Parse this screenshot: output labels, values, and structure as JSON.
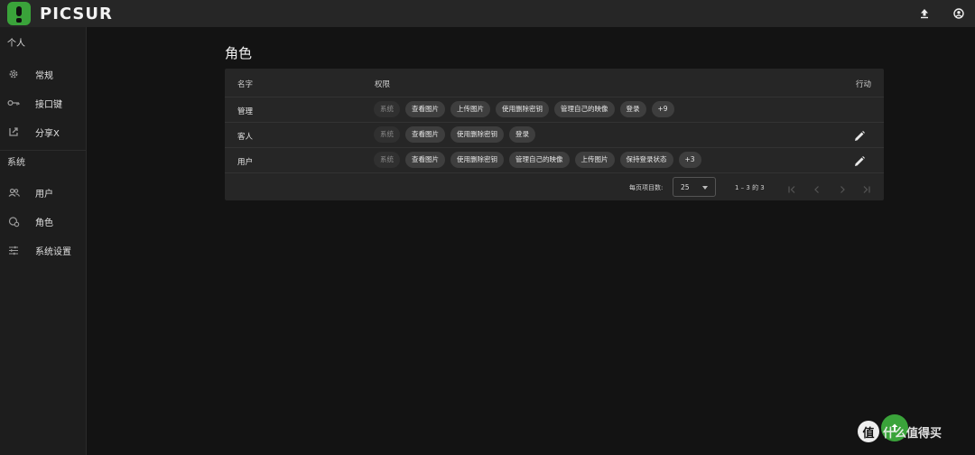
{
  "app": {
    "logo_text": "PICSUR",
    "brand_color": "#3aa33a"
  },
  "header_icons": [
    "upload-icon",
    "account-icon"
  ],
  "sidebar": {
    "section_personal": "个人",
    "section_system": "系统",
    "items": [
      {
        "label": "常规",
        "icon": "gear-icon"
      },
      {
        "label": "接口键",
        "icon": "key-icon"
      },
      {
        "label": "分享X",
        "icon": "share-icon"
      },
      {
        "label": "用户",
        "icon": "users-icon"
      },
      {
        "label": "角色",
        "icon": "roles-icon"
      },
      {
        "label": "系统设置",
        "icon": "sliders-icon"
      }
    ]
  },
  "main": {
    "title": "角色",
    "table": {
      "headers": {
        "name": "名字",
        "permissions": "权限",
        "actions": "行动"
      },
      "rows": [
        {
          "name": "管理",
          "chips": [
            "系统",
            "查看图片",
            "上传图片",
            "使用删除密钥",
            "管理自己的映像",
            "登录",
            "+9"
          ]
        },
        {
          "name": "客人",
          "chips": [
            "系统",
            "查看图片",
            "使用删除密钥",
            "登录"
          ]
        },
        {
          "name": "用户",
          "chips": [
            "系统",
            "查看图片",
            "使用删除密钥",
            "管理自己的映像",
            "上传图片",
            "保持登录状态",
            "+3"
          ]
        }
      ]
    },
    "pagination": {
      "per_page_label": "每页项目数:",
      "per_page_value": "25",
      "range_text": "1 – 3 的 3"
    }
  },
  "watermark": {
    "badge": "值",
    "text": "什么值得买"
  }
}
